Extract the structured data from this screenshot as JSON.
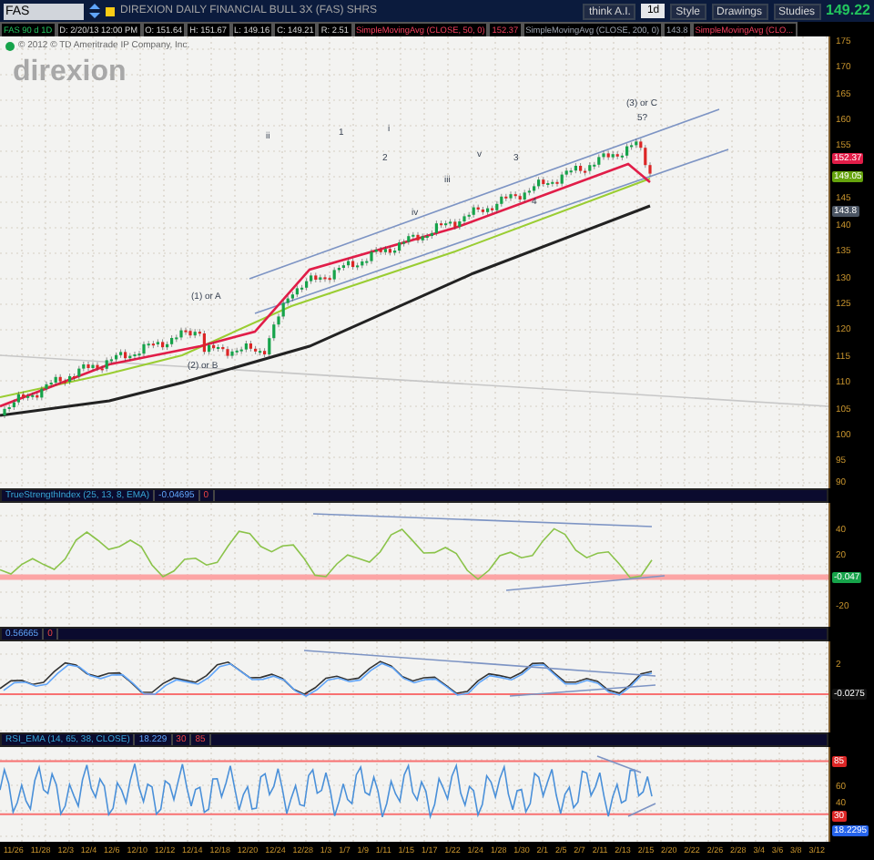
{
  "toolbar": {
    "symbol": "FAS",
    "title": "DIREXION DAILY FINANCIAL BULL 3X (FAS) SHRS",
    "buttons": [
      {
        "label": "think A.I.",
        "kind": "plain"
      },
      {
        "label": "1d",
        "kind": "box"
      },
      {
        "label": "Style",
        "kind": "plain"
      },
      {
        "label": "Drawings",
        "kind": "plain"
      },
      {
        "label": "Studies",
        "kind": "plain"
      }
    ],
    "last_price": "149.22"
  },
  "info_bar": [
    {
      "text": "FAS 90 d 1D",
      "kind": "symbol"
    },
    {
      "text": "D: 2/20/13 12:00 PM",
      "kind": "quote"
    },
    {
      "text": "O: 151.64",
      "kind": "quote"
    },
    {
      "text": "H: 151.67",
      "kind": "quote"
    },
    {
      "text": "L: 149.16",
      "kind": "quote"
    },
    {
      "text": "C: 149.21",
      "kind": "quote"
    },
    {
      "text": "R: 2.51",
      "kind": "quote"
    },
    {
      "text": "SimpleMovingAvg (CLOSE, 50, 0)",
      "kind": "study"
    },
    {
      "text": "152.37",
      "kind": "study"
    },
    {
      "text": "SimpleMovingAvg (CLOSE, 200, 0)",
      "kind": "study_gray"
    },
    {
      "text": "143.8",
      "kind": "study_gray"
    },
    {
      "text": "SimpleMovingAvg (CLO...",
      "kind": "study"
    }
  ],
  "price_chart": {
    "copyright": "© 2012 © TD Ameritrade IP Company, Inc.",
    "logo": "direxion",
    "y_labels": [
      "175",
      "170",
      "165",
      "160",
      "155",
      "145",
      "140",
      "135",
      "130",
      "125",
      "120",
      "115",
      "110",
      "105",
      "100",
      "95",
      "90"
    ],
    "badges": [
      {
        "text": "152.37",
        "color": "#e11d48"
      },
      {
        "text": "149.05",
        "color": "#65a30d"
      },
      {
        "text": "143.8",
        "color": "#4b5563"
      }
    ],
    "annotations": [
      "(1) or A",
      "(2) or B",
      "(3) or C",
      "5?",
      "i",
      "ii",
      "iii",
      "iv",
      "v",
      "1",
      "2",
      "3",
      "4"
    ]
  },
  "panels": [
    {
      "header": [
        "TrueStrengthIndex (25, 13, 8, EMA)",
        "-0.04695",
        "0"
      ],
      "y_labels": [
        "40",
        "20",
        "-20"
      ],
      "badges": [
        {
          "text": "-0.047",
          "color": "#16a34a"
        }
      ]
    },
    {
      "header": [
        "0.56665",
        "0"
      ],
      "y_labels": [
        "2"
      ],
      "badges": [
        {
          "text": "-0.0275",
          "color": "#111111"
        }
      ]
    },
    {
      "header": [
        "RSI_EMA (14, 65, 38, CLOSE)",
        "18.229",
        "30",
        "85"
      ],
      "y_labels": [
        "60",
        "40"
      ],
      "badges": [
        {
          "text": "85",
          "color": "#dc2626"
        },
        {
          "text": "30",
          "color": "#dc2626"
        },
        {
          "text": "18.2295",
          "color": "#2563eb"
        }
      ]
    }
  ],
  "dates": [
    "11/26",
    "11/28",
    "12/3",
    "12/4",
    "12/6",
    "12/10",
    "12/12",
    "12/14",
    "12/18",
    "12/20",
    "12/24",
    "12/28",
    "1/3",
    "1/7",
    "1/9",
    "1/11",
    "1/15",
    "1/17",
    "1/22",
    "1/24",
    "1/28",
    "1/30",
    "2/1",
    "2/5",
    "2/7",
    "2/11",
    "2/13",
    "2/15",
    "2/20",
    "2/22",
    "2/26",
    "2/28",
    "3/4",
    "3/6",
    "3/8",
    "3/12"
  ]
}
